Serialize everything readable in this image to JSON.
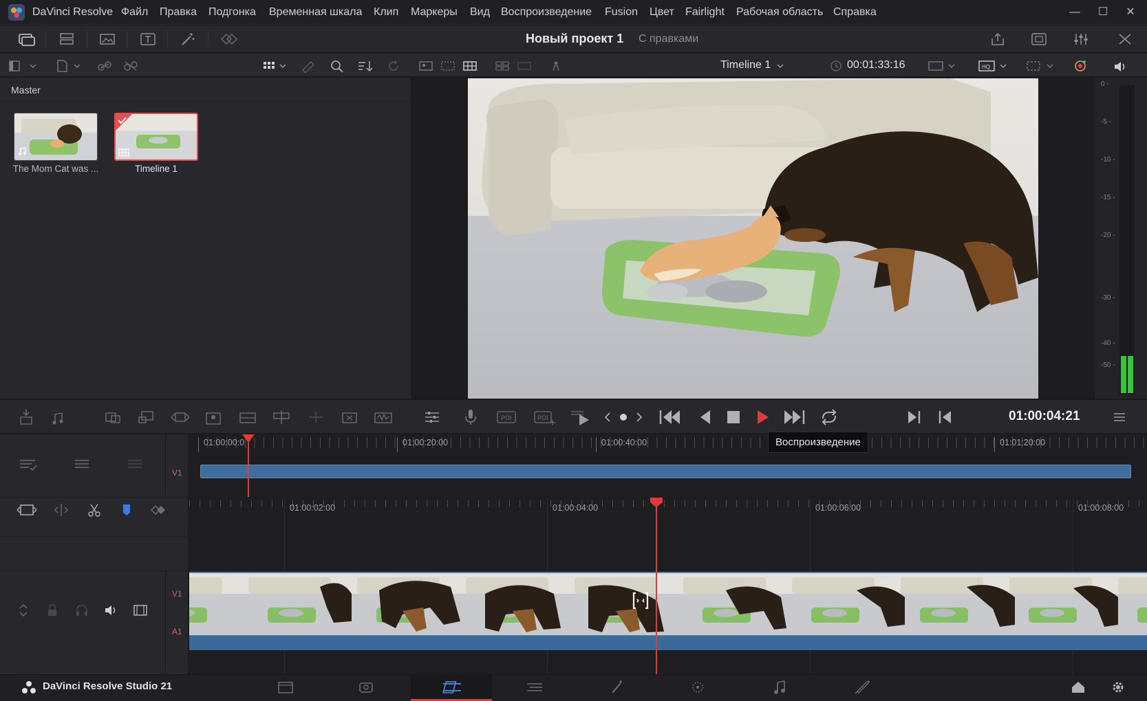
{
  "app": {
    "name": "DaVinci Resolve",
    "menu": [
      "Файл",
      "Правка",
      "Подгонка",
      "Временная шкала",
      "Клип",
      "Маркеры",
      "Вид",
      "Воспроизведение",
      "Fusion",
      "Цвет",
      "Fairlight",
      "Рабочая область",
      "Справка"
    ]
  },
  "window_controls": {
    "minimize": "—",
    "maximize": "☐",
    "close": "✕"
  },
  "project": {
    "title": "Новый проект 1",
    "status": "С правками"
  },
  "viewer": {
    "timeline_name": "Timeline 1",
    "source_timecode": "00:01:33:16"
  },
  "media_pool": {
    "bin": "Master",
    "clips": [
      {
        "label": "The Mom Cat was ...",
        "selected": false
      },
      {
        "label": "Timeline 1",
        "selected": true
      }
    ]
  },
  "meter": {
    "ticks": [
      "0 -",
      "-5 -",
      "-10 -",
      "-15 -",
      "-20 -",
      "-30 -",
      "-40 -",
      "-50 -"
    ]
  },
  "transport": {
    "record_timecode": "01:00:04:21",
    "tooltip": "Воспроизведение"
  },
  "upper_timeline": {
    "ruler": [
      "01:00:00:0",
      "01:00:20:00",
      "01:00:40:00",
      "01:01:20:00"
    ],
    "track": "V1"
  },
  "lower_timeline": {
    "ruler": [
      "01:00:02:00",
      "01:00:04:00",
      "01:00:06:00",
      "01:00:08:00"
    ],
    "video_track": "V1",
    "audio_track": "A1"
  },
  "footer": {
    "brand": "DaVinci Resolve Studio 21"
  },
  "colors": {
    "accent_red": "#e03a3a",
    "clip_blue": "#3f6e9c",
    "audio_blue": "#3a6b98",
    "meter_green": "#37c43a"
  }
}
